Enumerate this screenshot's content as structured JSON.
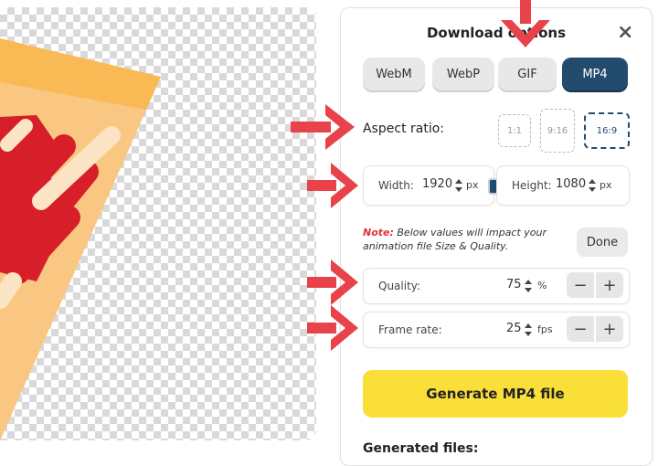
{
  "panel": {
    "title": "Download options",
    "close_icon": "close-icon"
  },
  "formats": [
    {
      "label": "WebM",
      "active": false
    },
    {
      "label": "WebP",
      "active": false
    },
    {
      "label": "GIF",
      "active": false
    },
    {
      "label": "MP4",
      "active": true
    }
  ],
  "aspect": {
    "label": "Aspect ratio:",
    "options": [
      "1:1",
      "9:16",
      "16:9"
    ],
    "selected": "16:9"
  },
  "dimensions": {
    "width_label": "Width:",
    "width_value": "1920",
    "height_label": "Height:",
    "height_value": "1080",
    "unit": "px"
  },
  "note": {
    "prefix": "Note:",
    "text": "Below values will impact your animation file Size & Quality.",
    "done_label": "Done"
  },
  "quality": {
    "label": "Quality:",
    "value": "75",
    "unit": "%"
  },
  "framerate": {
    "label": "Frame rate:",
    "value": "25",
    "unit": "fps"
  },
  "controls": {
    "minus": "−",
    "plus": "+"
  },
  "generate_label": "Generate MP4 file",
  "generated_files_label": "Generated files:",
  "colors": {
    "accent": "#234b6e",
    "generate": "#fadf38",
    "arrow": "#e8424a",
    "note_red": "#e0323a"
  }
}
